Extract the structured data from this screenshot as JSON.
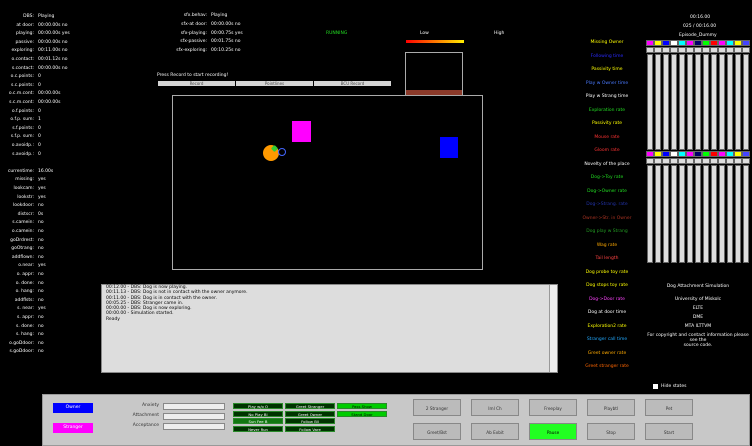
{
  "left_stats": [
    {
      "k": "DBS:",
      "v": "Playing"
    },
    {
      "k": "at door:",
      "v": "00:00.00s no"
    },
    {
      "k": "playing:",
      "v": "00:00.00s yes"
    },
    {
      "k": "passive:",
      "v": "00:00.00s no"
    },
    {
      "k": "exploring:",
      "v": "00:11.00s no"
    },
    {
      "k": "o.contact:",
      "v": "00:01.12s no"
    },
    {
      "k": "s.contact:",
      "v": "00:00.00s no"
    },
    {
      "k": "o.c.points:",
      "v": "0"
    },
    {
      "k": "s.c.points:",
      "v": "0"
    },
    {
      "k": "o.c.m.cont:",
      "v": "00:00.00s"
    },
    {
      "k": "s.c.m.cont:",
      "v": "00:00.00s"
    },
    {
      "k": "o.f.points:",
      "v": "0"
    },
    {
      "k": "o.f.p. sum:",
      "v": "1"
    },
    {
      "k": "s.f.points:",
      "v": "0"
    },
    {
      "k": "s.f.p. sum:",
      "v": "0"
    },
    {
      "k": "o.avoidp.:",
      "v": "0"
    },
    {
      "k": "s.avoidp.:",
      "v": "0"
    },
    {
      "k": "",
      "v": ""
    },
    {
      "k": "currentime:",
      "v": "16.00s"
    },
    {
      "k": "missing:",
      "v": "yes"
    },
    {
      "k": "lookcam:",
      "v": "yes"
    },
    {
      "k": "lookstr:",
      "v": "yes"
    },
    {
      "k": "lookdoor:",
      "v": "no"
    },
    {
      "k": "distscr:",
      "v": "0s"
    },
    {
      "k": "s.camein:",
      "v": "no"
    },
    {
      "k": "o.camein:",
      "v": "no"
    },
    {
      "k": "goDrdrest:",
      "v": "no"
    },
    {
      "k": "goOtrang:",
      "v": "no"
    },
    {
      "k": "addflown:",
      "v": "no"
    },
    {
      "k": "o.near:",
      "v": "yes"
    },
    {
      "k": "o. appr:",
      "v": "no"
    },
    {
      "k": "o. done:",
      "v": "no"
    },
    {
      "k": "o. hang:",
      "v": "no"
    },
    {
      "k": "addflsts:",
      "v": "no"
    },
    {
      "k": "s. near:",
      "v": "yes"
    },
    {
      "k": "s. appr:",
      "v": "no"
    },
    {
      "k": "s. done:",
      "v": "no"
    },
    {
      "k": "s. hang:",
      "v": "no"
    },
    {
      "k": "o.goDdoor:",
      "v": "no"
    },
    {
      "k": "s.goDdoor:",
      "v": "no"
    }
  ],
  "top_stats": [
    {
      "k": "sfx.behav:",
      "v": "Playing"
    },
    {
      "k": "sfx-at door:",
      "v": "00:00.00s no"
    },
    {
      "k": "sfx-playing:",
      "v": "00:00.75s yes"
    },
    {
      "k": "sfx-passive:",
      "v": "00:01.75s no"
    },
    {
      "k": "sfx-exploring:",
      "v": "00:10.25s no"
    }
  ],
  "status_running": "RUNNING",
  "meter": {
    "low": "Low",
    "high": "High"
  },
  "record_hint": "Press Record to start recording!",
  "record_buttons": [
    "Record",
    "Pointlines",
    "BCU Record"
  ],
  "time_info": {
    "clock": "00:16.00",
    "counter": "025 / 00:16.00",
    "episode": "Episode_Dummy"
  },
  "right_labels": [
    {
      "t": "Missing Owner",
      "c": "#ffff00"
    },
    {
      "t": "Following time",
      "c": "#2a2aff"
    },
    {
      "t": "Passivity time",
      "c": "#ffff00"
    },
    {
      "t": "Play w Owner time",
      "c": "#4a7aff"
    },
    {
      "t": "Play w Strang time",
      "c": "#ffffff"
    },
    {
      "t": "Exploration rate",
      "c": "#22dd22"
    },
    {
      "t": "Passivity rate",
      "c": "#ffff00"
    },
    {
      "t": "Mouse rate",
      "c": "#ff3333"
    },
    {
      "t": "Gloom rate",
      "c": "#ff3333"
    },
    {
      "t": "Novelty of the place",
      "c": "#ffffff"
    },
    {
      "t": "Dog->Toy rate",
      "c": "#22dd22"
    },
    {
      "t": "Dog->Owner rate",
      "c": "#22dd22"
    },
    {
      "t": "Dog->Strang. rate",
      "c": "#2233aa"
    },
    {
      "t": "Owner->Str. in Owner",
      "c": "#aa3322"
    },
    {
      "t": "Dog play w Strang",
      "c": "#229922"
    },
    {
      "t": "Wag rate",
      "c": "#ffaa00"
    },
    {
      "t": "Tail length",
      "c": "#ff4444"
    },
    {
      "t": "Dog probe toy rate",
      "c": "#ffff00"
    },
    {
      "t": "Dog stops toy rate",
      "c": "#ffff00"
    },
    {
      "t": "Dog->Door rate",
      "c": "#ff44ff"
    },
    {
      "t": "Dog at door time",
      "c": "#ffffff"
    },
    {
      "t": "Exploration2 rate",
      "c": "#ffff00"
    },
    {
      "t": "Stranger call time",
      "c": "#22aaff"
    },
    {
      "t": "Greet owner rate",
      "c": "#ffaa00"
    },
    {
      "t": "Greet stranger rate",
      "c": "#ff6600"
    }
  ],
  "about": {
    "title": "Dog Attachment Simulation",
    "uni": "University of Miskolc",
    "elte": "ELTE",
    "dme": "DME",
    "mta": "MTA ILTTVM",
    "copy1": "For copyright and contact information please see the",
    "copy2": "source code."
  },
  "log_lines": [
    "00:12.00 - DBS: Dog is now playing.",
    "00:11.13 - DBS: Dog is not in contact with the owner anymore.",
    "00:11.00 - DBS: Dog is in contact with the owner.",
    "00:05.25 - DBS: Stranger came in.",
    "00:00.00 - DBS: Dog is now exploring.",
    "00:00.00 - Simulation started.",
    "Ready"
  ],
  "hide_states": "Hide states",
  "bottom": {
    "owner": "Owner",
    "stranger": "Stranger",
    "sliders": [
      "Anxiety",
      "Attachment",
      "Acceptance"
    ],
    "green_buttons": [
      [
        "Play w/o O",
        "Greet Stranger",
        "Pass Show"
      ],
      [
        "No Play Bl",
        "Greet Owner",
        "Stand Door"
      ],
      [
        "Sun Fee B",
        "Follow Bll",
        ""
      ],
      [
        "Never Run",
        "Follow Vare",
        ""
      ]
    ],
    "buttons": [
      {
        "l": "2 Stranger"
      },
      {
        "l": "Iml Ch"
      },
      {
        "l": "Freeplay"
      },
      {
        "l": "Playbtl"
      },
      {
        "l": "Pet"
      },
      {
        "l": "Greet/Bst"
      },
      {
        "l": "Ab Exbit"
      },
      {
        "l": "Pause"
      },
      {
        "l": "Stop"
      },
      {
        "l": "Start"
      }
    ]
  },
  "colors": {
    "owner": "#0000ff",
    "stranger": "#ff00ff",
    "toy": "#ff9900"
  }
}
